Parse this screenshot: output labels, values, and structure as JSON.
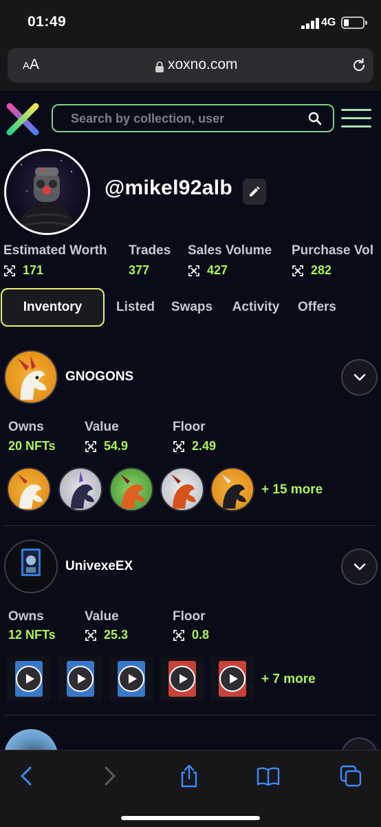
{
  "status_bar": {
    "time": "01:49",
    "network": "4G"
  },
  "browser": {
    "aa_small": "A",
    "aa_large": "A",
    "url": "xoxno.com"
  },
  "header": {
    "search_placeholder": "Search by collection, user"
  },
  "profile": {
    "username": "@mikel92alb"
  },
  "stats": [
    {
      "label": "Estimated Worth",
      "value": "171",
      "egld": true
    },
    {
      "label": "Trades",
      "value": "377",
      "egld": false
    },
    {
      "label": "Sales Volume",
      "value": "427",
      "egld": true
    },
    {
      "label": "Purchase Vol",
      "value": "282",
      "egld": true
    }
  ],
  "tabs": [
    "Inventory",
    "Listed",
    "Swaps",
    "Activity",
    "Offers"
  ],
  "active_tab": "Inventory",
  "collections": [
    {
      "name": "GNOGONS",
      "owns_label": "Owns",
      "owns_value": "20 NFTs",
      "value_label": "Value",
      "value_value": "54.9",
      "floor_label": "Floor",
      "floor_value": "2.49",
      "more": "+ 15 more",
      "thumb_icons": [
        "dragon-nft-icon",
        "dragon-nft-icon",
        "dragon-nft-icon",
        "dragon-nft-icon",
        "dragon-nft-icon"
      ]
    },
    {
      "name": "UnivexeEX",
      "owns_label": "Owns",
      "owns_value": "12 NFTs",
      "value_label": "Value",
      "value_value": "25.3",
      "floor_label": "Floor",
      "floor_value": "0.8",
      "more": "+ 7 more",
      "thumb_icons": [
        "play-video-icon",
        "play-video-icon",
        "play-video-icon",
        "play-video-icon",
        "play-video-icon"
      ]
    }
  ],
  "colors": {
    "background": "#0a0b18",
    "accent_green": "#a9f25c",
    "active_tab_border": "#e6ef6f",
    "search_border": "#7fd08c"
  }
}
